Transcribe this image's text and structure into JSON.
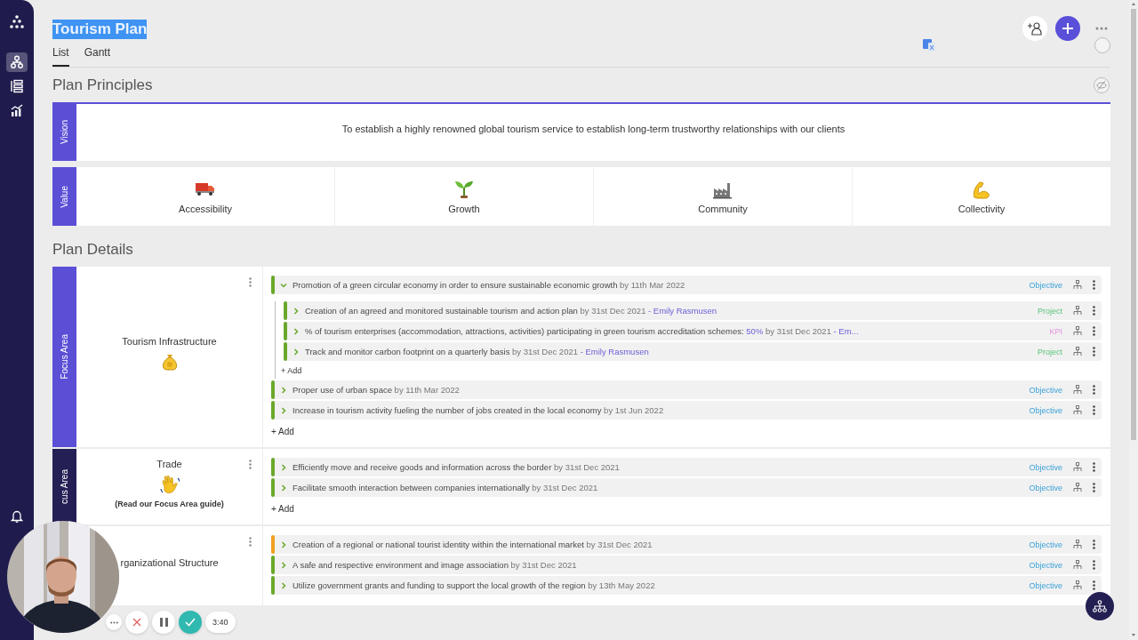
{
  "sidebar": {
    "items": [
      {
        "selected": true
      },
      {
        "selected": false
      },
      {
        "selected": false
      }
    ]
  },
  "title": {
    "text": "Tourism Plan",
    "highlighted": true
  },
  "tabs": [
    {
      "label": "List",
      "selected": true
    },
    {
      "label": "Gantt",
      "selected": false
    }
  ],
  "principles": {
    "heading": "Plan Principles",
    "vision": {
      "label": "Vision",
      "text": "To establish a highly renowned global tourism service to establish long-term trustworthy relationships with our clients"
    },
    "values": {
      "label": "Value",
      "items": [
        {
          "name": "Accessibility"
        },
        {
          "name": "Growth"
        },
        {
          "name": "Community"
        },
        {
          "name": "Collectivity"
        }
      ]
    }
  },
  "details": {
    "heading": "Plan Details",
    "focus_areas": [
      {
        "band_label": "Focus Area",
        "color": "#5b4fd6",
        "name": "Tourism Infrastructure",
        "add_label": "+ Add",
        "objectives": [
          {
            "title": "Promotion of a green circular economy in order to ensure sustainable economic growth",
            "due": "by 11th Mar 2022",
            "kind": "objective",
            "type": "Objective",
            "color": "#6aa82c",
            "expanded": true,
            "add_label": "+ Add",
            "children": [
              {
                "title": "Creation of an agreed and monitored sustainable tourism and action plan",
                "due": "by 31st Dec 2021",
                "owner": "- Emily Rasmusen",
                "kind": "project",
                "type": "Project",
                "color": "#6aa82c",
                "expanded": false
              },
              {
                "title": "% of tourism enterprises (accommodation, attractions, activities) participating in green tourism accreditation schemes:",
                "value": "50%",
                "due": "by 31st Dec 2021",
                "owner": "- Em...",
                "kind": "kpi",
                "type": "KPI",
                "color": "#6aa82c",
                "expanded": false
              },
              {
                "title": "Track and monitor carbon footprint on a quarterly basis",
                "due": "by 31st Dec 2021",
                "owner": "- Emily Rasmusen",
                "kind": "project",
                "type": "Project",
                "color": "#6aa82c",
                "expanded": false
              }
            ]
          },
          {
            "title": "Proper use of urban space",
            "due": "by 11th Mar 2022",
            "kind": "objective",
            "type": "Objective",
            "color": "#6aa82c",
            "expanded": false
          },
          {
            "title": "Increase in tourism activity fueling the number of jobs created in the local economy",
            "due": "by 1st Jun 2022",
            "kind": "objective",
            "type": "Objective",
            "color": "#6aa82c",
            "expanded": false
          }
        ]
      },
      {
        "band_label": "cus Area",
        "color": "#241f55",
        "name": "Trade",
        "note": "(Read our Focus Area guide)",
        "add_label": "+ Add",
        "objectives": [
          {
            "title": "Efficiently move and receive goods and information across the border",
            "due": "by 31st Dec 2021",
            "kind": "objective",
            "type": "Objective",
            "color": "#6aa82c",
            "expanded": false
          },
          {
            "title": "Facilitate smooth interaction between companies internationally",
            "due": "by 31st Dec 2021",
            "kind": "objective",
            "type": "Objective",
            "color": "#6aa82c",
            "expanded": false
          }
        ]
      },
      {
        "name": "rganizational Structure",
        "objectives": [
          {
            "title": "Creation of a regional or national tourist identity within the international market",
            "due": "by 31st Dec 2021",
            "kind": "objective",
            "type": "Objective",
            "color": "#f0a020",
            "expanded": false
          },
          {
            "title": "A safe and respective environment and image association",
            "due": "by 31st Dec 2021",
            "kind": "objective",
            "type": "Objective",
            "color": "#6aa82c",
            "expanded": false
          },
          {
            "title": "Utilize government grants and funding to support the local growth of the region",
            "due": "by 13th May 2022",
            "kind": "objective",
            "type": "Objective",
            "color": "#6aa82c",
            "expanded": false
          }
        ]
      }
    ]
  },
  "recorder": {
    "time": "3:40"
  }
}
